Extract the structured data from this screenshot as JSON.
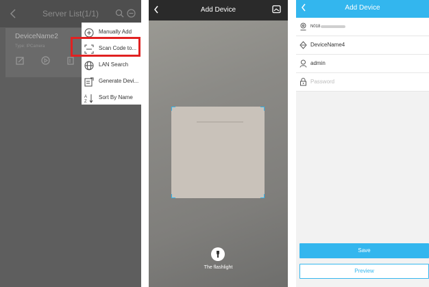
{
  "colors": {
    "accent": "#33b6ee",
    "highlight_border": "#e12121"
  },
  "server_list": {
    "title": "Server List(1/1)",
    "device": {
      "name": "DeviceName2",
      "type": "Type: IPCamera"
    },
    "menu": [
      {
        "label": "Manually Add",
        "icon": "plus-circle-icon"
      },
      {
        "label": "Scan Code to...",
        "icon": "scan-icon"
      },
      {
        "label": "LAN Search",
        "icon": "globe-icon"
      },
      {
        "label": "Generate Devi...",
        "icon": "generate-icon"
      },
      {
        "label": "Sort By Name",
        "icon": "sort-az-icon"
      }
    ]
  },
  "scanner": {
    "title": "Add Device",
    "flashlight_label": "The flashlight"
  },
  "add_device_form": {
    "title": "Add Device",
    "device_id_value": "N018",
    "device_name_value": "DeviceName4",
    "username_value": "admin",
    "password_placeholder": "Password",
    "save_label": "Save",
    "preview_label": "Preview"
  }
}
